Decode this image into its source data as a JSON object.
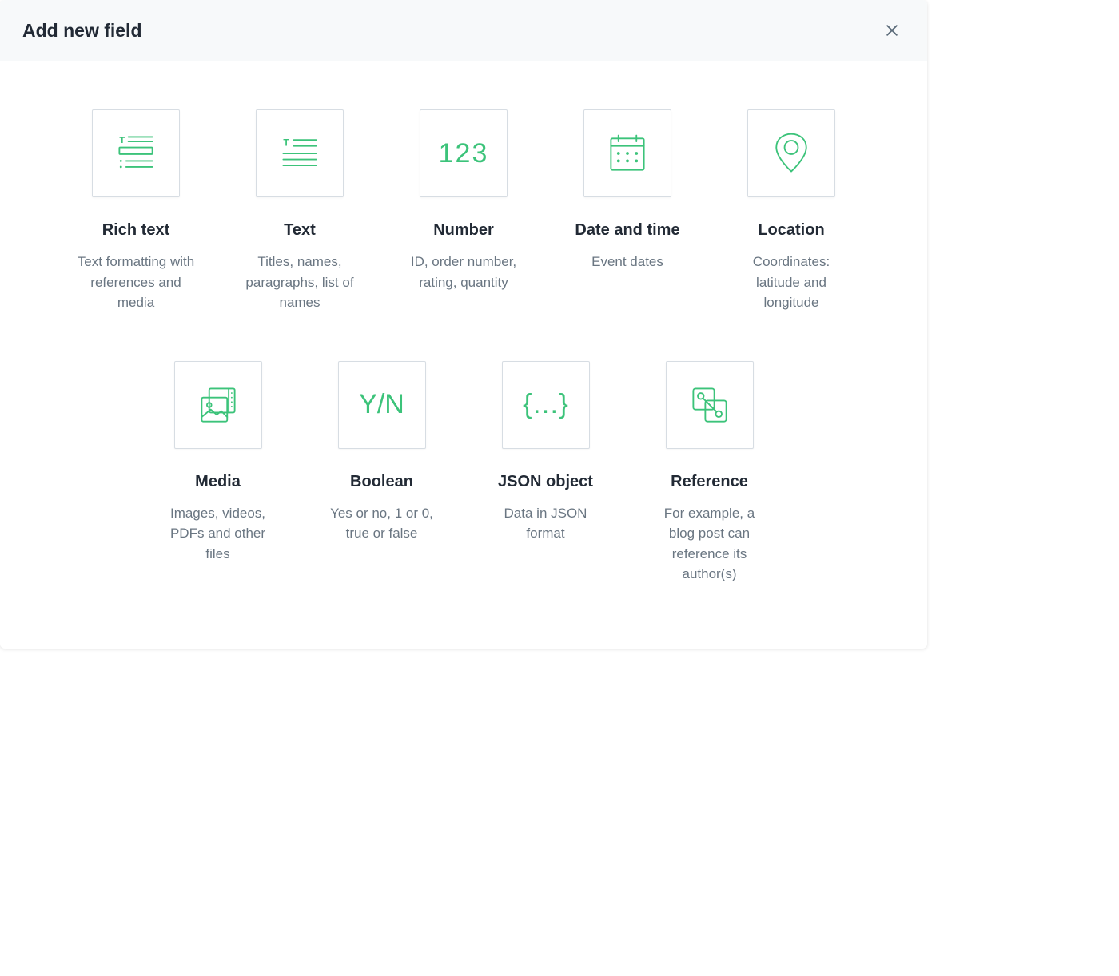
{
  "dialog": {
    "title": "Add new field"
  },
  "row1": [
    {
      "icon": "rich-text-icon",
      "title": "Rich text",
      "desc": "Text formatting with references and media"
    },
    {
      "icon": "text-icon",
      "title": "Text",
      "desc": "Titles, names, paragraphs, list of names"
    },
    {
      "icon": "number-icon",
      "title": "Number",
      "desc": "ID, order number, rating, quantity"
    },
    {
      "icon": "date-time-icon",
      "title": "Date and time",
      "desc": "Event dates"
    },
    {
      "icon": "location-icon",
      "title": "Location",
      "desc": "Coordinates: latitude and longitude"
    }
  ],
  "row2": [
    {
      "icon": "media-icon",
      "title": "Media",
      "desc": "Images, videos, PDFs and other files"
    },
    {
      "icon": "boolean-icon",
      "title": "Boolean",
      "desc": "Yes or no, 1 or 0, true or false"
    },
    {
      "icon": "json-icon",
      "title": "JSON object",
      "desc": "Data in JSON format"
    },
    {
      "icon": "reference-icon",
      "title": "Reference",
      "desc": "For example, a blog post can reference its author(s)"
    }
  ],
  "glyphs": {
    "number": "123",
    "boolean": "Y/N",
    "json": "{…}"
  }
}
